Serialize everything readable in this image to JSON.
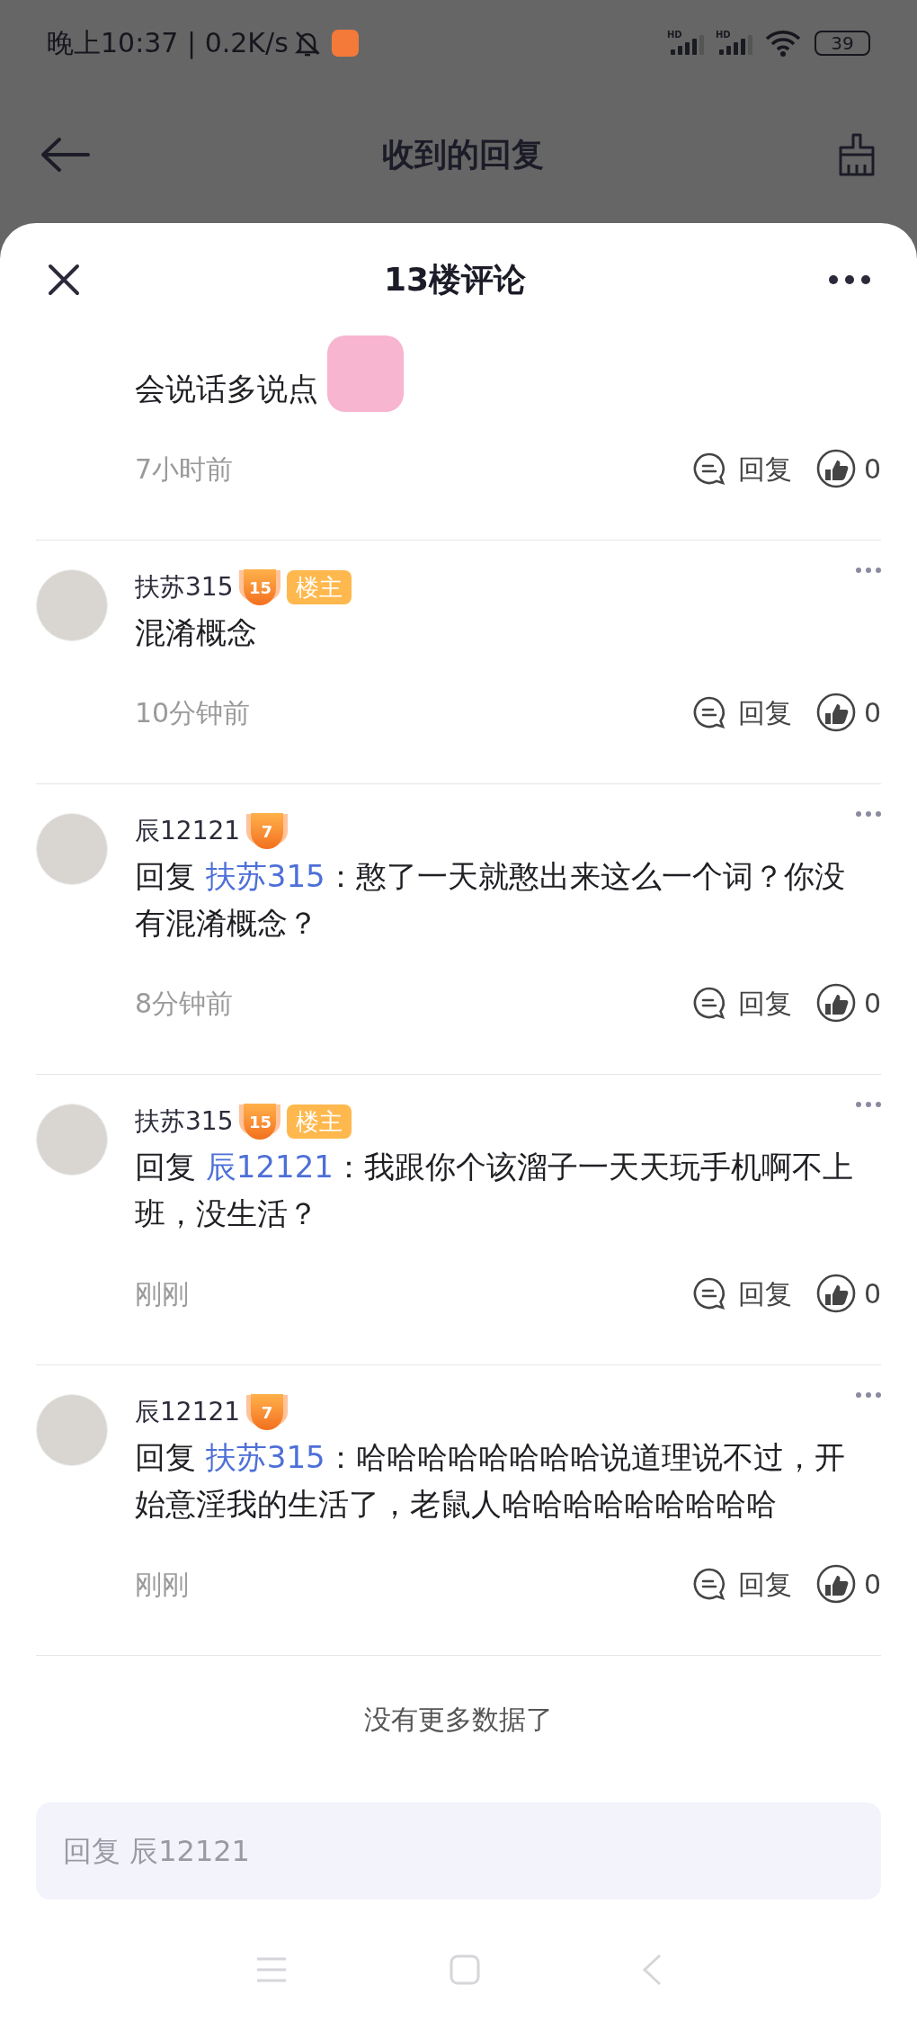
{
  "status_bar": {
    "time": "晚上10:37 | 0.2K/s",
    "battery": "39",
    "signal_labels": [
      "HD",
      "HD"
    ]
  },
  "page": {
    "title": "收到的回复"
  },
  "sheet": {
    "title": "13楼评论"
  },
  "comments": [
    {
      "kind": "continued",
      "text": "会说话多说点",
      "sticker": true,
      "time": "7小时前",
      "reply_label": "回复",
      "likes": "0"
    },
    {
      "kind": "comment",
      "user": "扶苏315",
      "level": "15",
      "badge": "楼主",
      "text": "混淆概念",
      "time": "10分钟前",
      "reply_label": "回复",
      "likes": "0"
    },
    {
      "kind": "comment",
      "user": "辰12121",
      "level": "7",
      "reply_prefix": "回复",
      "reply_to": "扶苏315",
      "text": "：憨了一天就憨出来这么一个词？你没有混淆概念？",
      "time": "8分钟前",
      "reply_label": "回复",
      "likes": "0"
    },
    {
      "kind": "comment",
      "user": "扶苏315",
      "level": "15",
      "badge": "楼主",
      "reply_prefix": "回复",
      "reply_to": "辰12121",
      "text": "：我跟你个该溜子一天天玩手机啊不上班，没生活？",
      "time": "刚刚",
      "reply_label": "回复",
      "likes": "0"
    },
    {
      "kind": "comment",
      "user": "辰12121",
      "level": "7",
      "reply_prefix": "回复",
      "reply_to": "扶苏315",
      "text": "：哈哈哈哈哈哈哈哈说道理说不过，开始意淫我的生活了，老鼠人哈哈哈哈哈哈哈哈哈",
      "time": "刚刚",
      "reply_label": "回复",
      "likes": "0"
    }
  ],
  "footer": "没有更多数据了",
  "reply_box": {
    "placeholder": "回复 辰12121"
  }
}
